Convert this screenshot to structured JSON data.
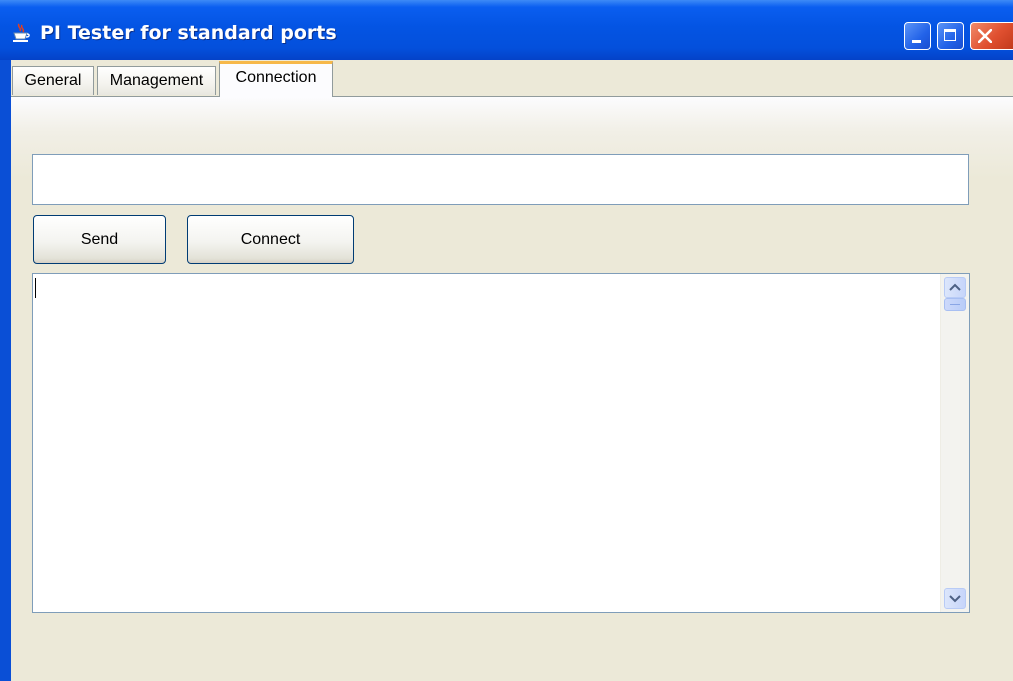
{
  "window": {
    "title": "PI Tester for standard ports"
  },
  "tabs": [
    {
      "label": "General",
      "selected": false
    },
    {
      "label": "Management",
      "selected": false
    },
    {
      "label": "Connection",
      "selected": true
    }
  ],
  "connection": {
    "input_value": "",
    "send_label": "Send",
    "connect_label": "Connect",
    "output_text": ""
  },
  "colors": {
    "titlebar": "#0454e3",
    "background": "#ece9d8",
    "selected_tab_accent": "#f6b84a",
    "field_border": "#7f9db9"
  },
  "icons": {
    "app": "java-coffee-icon",
    "minimize": "minimize-icon",
    "maximize": "maximize-icon",
    "close": "close-icon",
    "scroll_up": "chevron-up-icon",
    "scroll_down": "chevron-down-icon"
  }
}
